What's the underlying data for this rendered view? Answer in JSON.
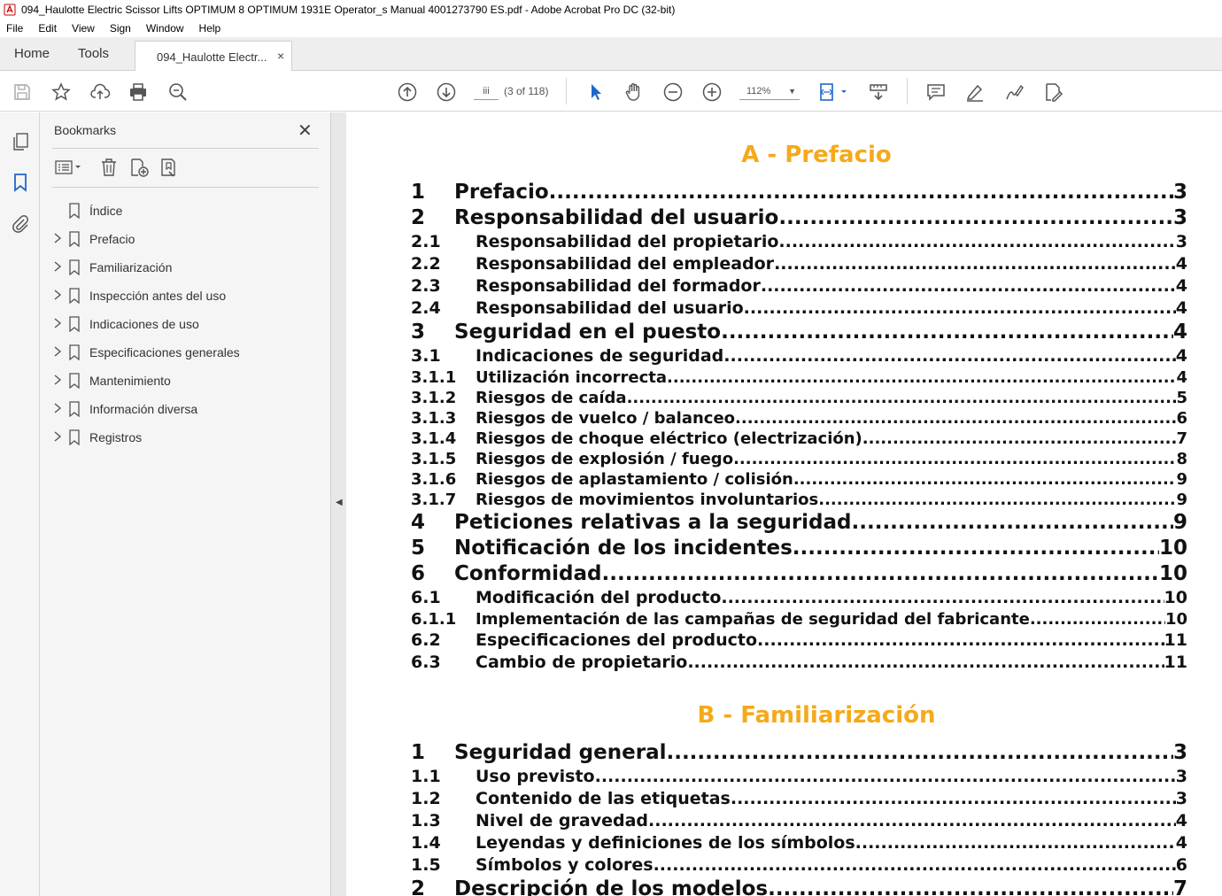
{
  "window": {
    "title": "094_Haulotte Electric Scissor Lifts OPTIMUM 8 OPTIMUM 1931E Operator_s Manual 4001273790 ES.pdf - Adobe Acrobat Pro DC (32-bit)"
  },
  "menu": [
    "File",
    "Edit",
    "View",
    "Sign",
    "Window",
    "Help"
  ],
  "tabs": {
    "home": "Home",
    "tools": "Tools",
    "document": "094_Haulotte Electr...",
    "close": "×"
  },
  "toolbar": {
    "page_input": "iii",
    "page_count": "(3 of 118)",
    "zoom": "112%"
  },
  "bookmarks": {
    "title": "Bookmarks",
    "close": "✕",
    "items": [
      {
        "label": "Índice",
        "expandable": false
      },
      {
        "label": "Prefacio",
        "expandable": true
      },
      {
        "label": "Familiarización",
        "expandable": true
      },
      {
        "label": "Inspección antes del uso",
        "expandable": true
      },
      {
        "label": "Indicaciones de uso",
        "expandable": true
      },
      {
        "label": "Especificaciones generales",
        "expandable": true
      },
      {
        "label": "Mantenimiento",
        "expandable": true
      },
      {
        "label": "Información diversa",
        "expandable": true
      },
      {
        "label": "Registros",
        "expandable": true
      }
    ]
  },
  "document": {
    "section_a": {
      "heading": "A - Prefacio",
      "entries": [
        {
          "level": 1,
          "num": "1",
          "text": "Prefacio",
          "page": "3"
        },
        {
          "level": 1,
          "num": "2",
          "text": "Responsabilidad del usuario",
          "page": "3"
        },
        {
          "level": 2,
          "num": "2.1",
          "text": "Responsabilidad del propietario",
          "page": "3"
        },
        {
          "level": 2,
          "num": "2.2",
          "text": "Responsabilidad del empleador",
          "page": "4"
        },
        {
          "level": 2,
          "num": "2.3",
          "text": "Responsabilidad del formador",
          "page": "4"
        },
        {
          "level": 2,
          "num": "2.4",
          "text": "Responsabilidad del usuario",
          "page": "4"
        },
        {
          "level": 1,
          "num": "3",
          "text": "Seguridad en el puesto",
          "page": "4"
        },
        {
          "level": 2,
          "num": "3.1",
          "text": "Indicaciones de seguridad",
          "page": "4"
        },
        {
          "level": 3,
          "num": "3.1.1",
          "text": "Utilización incorrecta",
          "page": "4"
        },
        {
          "level": 3,
          "num": "3.1.2",
          "text": "Riesgos de caída",
          "page": "5"
        },
        {
          "level": 3,
          "num": "3.1.3",
          "text": "Riesgos de vuelco / balanceo",
          "page": "6"
        },
        {
          "level": 3,
          "num": "3.1.4",
          "text": "Riesgos de choque eléctrico (electrización)",
          "page": "7"
        },
        {
          "level": 3,
          "num": "3.1.5",
          "text": "Riesgos de explosión / fuego",
          "page": "8"
        },
        {
          "level": 3,
          "num": "3.1.6",
          "text": "Riesgos de aplastamiento / colisión",
          "page": "9"
        },
        {
          "level": 3,
          "num": "3.1.7",
          "text": "Riesgos de movimientos involuntarios",
          "page": "9"
        },
        {
          "level": 1,
          "num": "4",
          "text": "Peticiones relativas a la seguridad",
          "page": "9"
        },
        {
          "level": 1,
          "num": "5",
          "text": "Notificación de los incidentes",
          "page": "10"
        },
        {
          "level": 1,
          "num": "6",
          "text": "Conformidad",
          "page": "10"
        },
        {
          "level": 2,
          "num": "6.1",
          "text": "Modificación del producto",
          "page": "10"
        },
        {
          "level": 3,
          "num": "6.1.1",
          "text": "Implementación de las campañas de seguridad del fabricante",
          "page": "10"
        },
        {
          "level": 2,
          "num": "6.2",
          "text": "Especificaciones del producto",
          "page": "11"
        },
        {
          "level": 2,
          "num": "6.3",
          "text": "Cambio de propietario",
          "page": "11"
        }
      ]
    },
    "section_b": {
      "heading": "B - Familiarización",
      "entries": [
        {
          "level": 1,
          "num": "1",
          "text": "Seguridad general",
          "page": "3"
        },
        {
          "level": 2,
          "num": "1.1",
          "text": "Uso previsto",
          "page": "3"
        },
        {
          "level": 2,
          "num": "1.2",
          "text": "Contenido de las etiquetas",
          "page": "3"
        },
        {
          "level": 2,
          "num": "1.3",
          "text": "Nivel de gravedad",
          "page": "4"
        },
        {
          "level": 2,
          "num": "1.4",
          "text": "Leyendas y definiciones de los símbolos",
          "page": "4"
        },
        {
          "level": 2,
          "num": "1.5",
          "text": "Símbolos y colores",
          "page": "6"
        },
        {
          "level": 1,
          "num": "2",
          "text": "Descripción de los modelos",
          "page": "7"
        }
      ]
    }
  },
  "colors": {
    "heading": "#f5a91c",
    "toolbar_active": "#1f67c9"
  }
}
